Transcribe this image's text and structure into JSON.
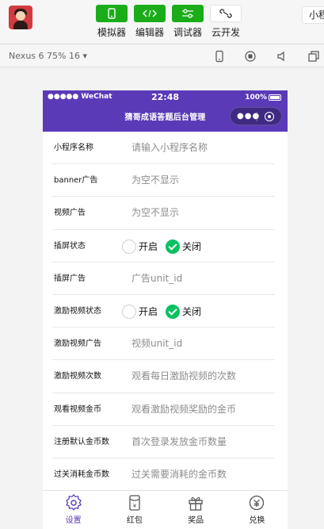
{
  "toolbar": {
    "tools": [
      {
        "label": "模拟器",
        "icon": "phone-icon"
      },
      {
        "label": "编辑器",
        "icon": "code-icon"
      },
      {
        "label": "调试器",
        "icon": "sliders-icon"
      },
      {
        "label": "云开发",
        "icon": "cloud-icon"
      }
    ],
    "mini_label": "小程"
  },
  "devbar": {
    "device_label": "Nexus 6 75% 16 ▾"
  },
  "statusbar": {
    "carrier": "●●●●● WeChat",
    "time": "22:48",
    "battery": "100%"
  },
  "nav": {
    "title": "猜哥成语答题后台管理",
    "capsule_more": "●●●"
  },
  "form": {
    "rows": [
      {
        "label": "小程序名称",
        "placeholder": "请输入小程序名称"
      },
      {
        "label": "banner广告",
        "placeholder": "为空不显示"
      },
      {
        "label": "视频广告",
        "placeholder": "为空不显示"
      },
      {
        "label": "插屏状态",
        "on_label": "开启",
        "off_label": "关闭",
        "selected": "关闭"
      },
      {
        "label": "插屏广告",
        "placeholder": "广告unit_id"
      },
      {
        "label": "激励视频状态",
        "on_label": "开启",
        "off_label": "关闭",
        "selected": "关闭"
      },
      {
        "label": "激励视频广告",
        "placeholder": "视频unit_id"
      },
      {
        "label": "激励视频次数",
        "placeholder": "观看每日激励视频的次数"
      },
      {
        "label": "观看视频金币",
        "placeholder": "观看激励视频奖励的金币"
      },
      {
        "label": "注册默认金币数",
        "placeholder": "首次登录发放金币数量"
      },
      {
        "label": "过关消耗金币数",
        "placeholder": "过关需要消耗的金币数"
      }
    ]
  },
  "tabbar": {
    "tabs": [
      {
        "label": "设置",
        "icon": "gear-icon",
        "active": true
      },
      {
        "label": "红包",
        "icon": "red-envelope-icon"
      },
      {
        "label": "奖品",
        "icon": "gift-icon"
      },
      {
        "label": "兑换",
        "icon": "exchange-icon"
      }
    ]
  },
  "colors": {
    "accent": "#5b3ab8",
    "tool_green": "#1aad19",
    "radio_checked": "#07c160"
  }
}
